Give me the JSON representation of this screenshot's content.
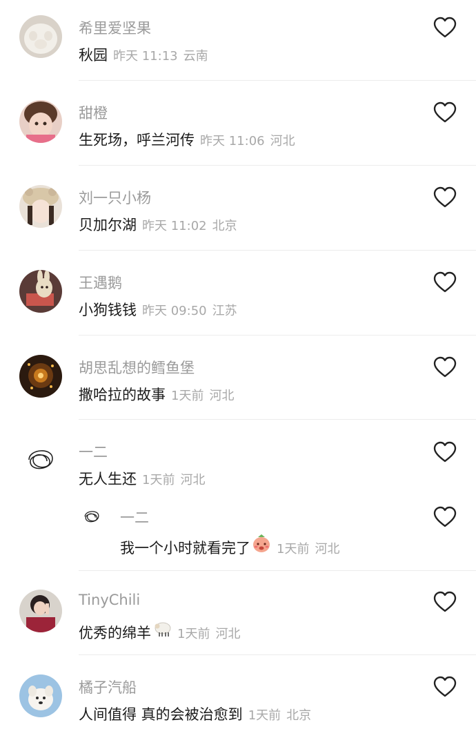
{
  "comments": [
    {
      "username": "希里爱坚果",
      "content": "秋园",
      "time": "昨天 11:13",
      "location": "云南",
      "avatar": "cat-paw-avatar",
      "like_icon": "heart-outline-icon"
    },
    {
      "username": "甜橙",
      "content": "生死场，呼兰河传",
      "time": "昨天 11:06",
      "location": "河北",
      "avatar": "little-girl-avatar",
      "like_icon": "heart-outline-icon"
    },
    {
      "username": "刘一只小杨",
      "content": "贝加尔湖",
      "time": "昨天 11:02",
      "location": "北京",
      "avatar": "girl-hat-avatar",
      "like_icon": "heart-outline-icon"
    },
    {
      "username": "王遇鹅",
      "content": "小狗钱钱",
      "time": "昨天 09:50",
      "location": "江苏",
      "avatar": "cartoon-rabbit-avatar",
      "like_icon": "heart-outline-icon"
    },
    {
      "username": "胡思乱想的鳕鱼堡",
      "content": "撒哈拉的故事",
      "time": "1天前",
      "location": "河北",
      "avatar": "warm-lights-avatar",
      "like_icon": "heart-outline-icon"
    },
    {
      "username": "一二",
      "content": "无人生还",
      "time": "1天前",
      "location": "河北",
      "avatar": "scribble-avatar",
      "like_icon": "heart-outline-icon"
    },
    {
      "username": "一二",
      "content": "我一个小时就看完了",
      "emoji": "blushing-face-emoji",
      "time": "1天前",
      "location": "河北",
      "avatar": "scribble-avatar",
      "like_icon": "heart-outline-icon"
    },
    {
      "username": "TinyChili",
      "content": "优秀的绵羊",
      "emoji": "sheep-emoji",
      "time": "1天前",
      "location": "河北",
      "avatar": "portrait-avatar",
      "like_icon": "heart-outline-icon"
    },
    {
      "username": "橘子汽船",
      "content": "人间值得 真的会被治愈到",
      "time": "1天前",
      "location": "北京",
      "avatar": "white-puppy-avatar",
      "like_icon": "heart-outline-icon"
    }
  ]
}
